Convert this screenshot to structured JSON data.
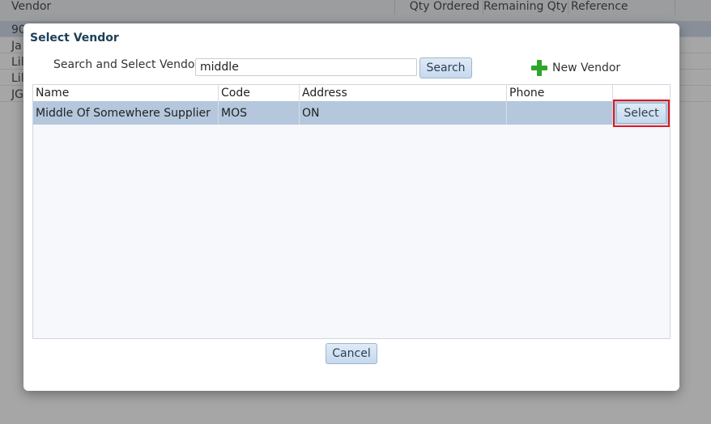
{
  "background": {
    "columns": [
      "Vendor",
      "Qty Ordered",
      "Remaining Qty",
      "Reference"
    ],
    "rows": [
      "90",
      "Ja",
      "Lil",
      "Lil",
      "JG"
    ]
  },
  "dialog": {
    "title": "Select Vendor",
    "search_label": "Search and Select Vendor:",
    "search_value": "middle",
    "search_button": "Search",
    "new_vendor_label": "New Vendor",
    "new_vendor_icon": "plus-icon",
    "table": {
      "headers": [
        "Name",
        "Code",
        "Address",
        "Phone"
      ],
      "rows": [
        {
          "name": "Middle Of Somewhere Supplier",
          "code": "MOS",
          "address": "ON",
          "phone": "",
          "action": "Select"
        }
      ]
    },
    "cancel_button": "Cancel"
  },
  "colors": {
    "title": "#1d3f57",
    "selected_row": "#b4c7dd",
    "highlight_border": "#e0141e",
    "plus_icon": "#2ea62e"
  }
}
